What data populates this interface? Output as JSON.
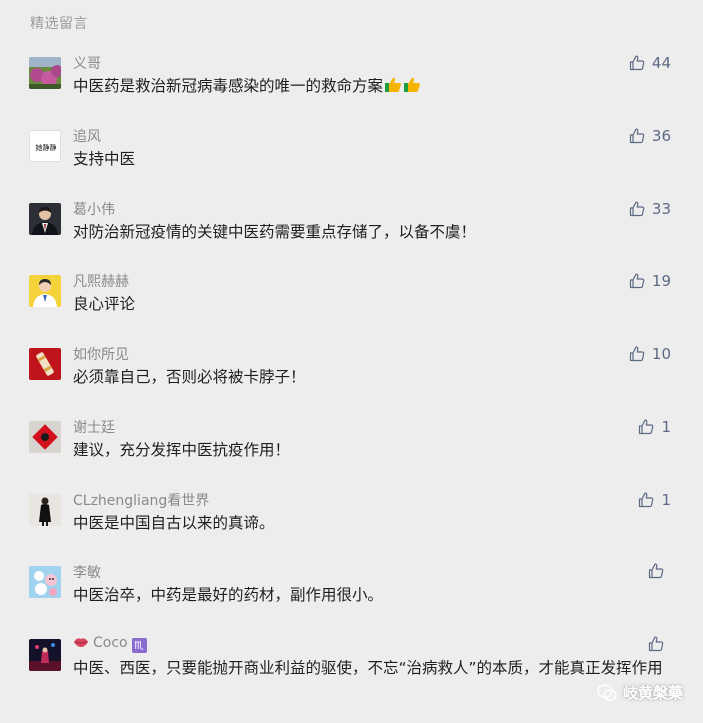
{
  "section_title": "精选留言",
  "comments": [
    {
      "nickname": "义哥",
      "text": "中医药是救治新冠病毒感染的唯一的救命方案",
      "likes": "44",
      "avatar_icon": "flower-photo-avatar"
    },
    {
      "nickname": "追风",
      "text": "支持中医",
      "likes": "36",
      "avatar_icon": "calligraphy-avatar",
      "avatar_text": "她静静"
    },
    {
      "nickname": "葛小伟",
      "text": "对防治新冠疫情的关键中医药需要重点存储了，以备不虞！",
      "likes": "33",
      "avatar_icon": "man-in-suit-avatar"
    },
    {
      "nickname": "凡熙赫赫",
      "text": "良心评论",
      "likes": "19",
      "avatar_icon": "person-yellow-bg-avatar"
    },
    {
      "nickname": "如你所见",
      "text": "必须靠自己，否则必将被卡脖子！",
      "likes": "10",
      "avatar_icon": "red-firecracker-avatar"
    },
    {
      "nickname": "谢士廷",
      "text": "建议，充分发挥中医抗疫作用！",
      "likes": "1",
      "avatar_icon": "red-fu-avatar"
    },
    {
      "nickname": "CLzhengliang看世界",
      "text": "中医是中国自古以来的真谛。",
      "likes": "1",
      "avatar_icon": "person-black-dress-avatar"
    },
    {
      "nickname": "李敏",
      "text": "中医治卒，中药是最好的药材，副作用很小。",
      "likes": "",
      "avatar_icon": "blue-cartoon-avatar"
    },
    {
      "nickname": "Coco",
      "text": "中医、西医，只要能抛开商业利益的驱使，不忘“治病救人”的本质，才能真正发挥作用",
      "likes": "",
      "avatar_icon": "night-stage-avatar"
    }
  ],
  "watermark": {
    "text": "岐黄槃藥"
  },
  "colors": {
    "background": "#ededed",
    "like": "#5d6a86",
    "nickname": "#8a8a8a",
    "text": "#1f1f1f"
  }
}
